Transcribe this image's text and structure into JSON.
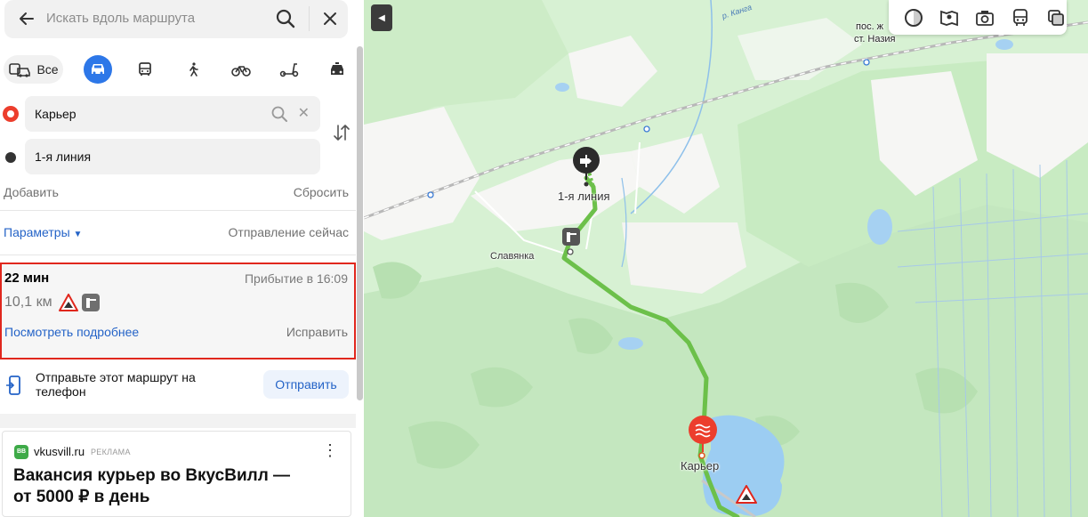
{
  "search": {
    "placeholder": "Искать вдоль маршрута"
  },
  "modes": {
    "all_label": "Все",
    "items": [
      "car",
      "bus",
      "walk",
      "bicycle",
      "scooter",
      "taxi"
    ],
    "active": "car",
    "accent": "#2d77e8"
  },
  "waypoints": {
    "from": "Карьер",
    "to": "1-я линия"
  },
  "actions": {
    "add": "Добавить",
    "reset": "Сбросить"
  },
  "params": {
    "label": "Параметры",
    "departure": "Отправление сейчас"
  },
  "route": {
    "duration": "22 мин",
    "arrival": "Прибытие в 16:09",
    "distance": "10,1 км",
    "details": "Посмотреть подробнее",
    "fix": "Исправить",
    "highlight_color": "#e0271d"
  },
  "send": {
    "text": "Отправьте этот маршрут на телефон",
    "button": "Отправить"
  },
  "ad": {
    "domain": "vkusvill.ru",
    "tag": "РЕКЛАМА",
    "title": "Вакансия курьер во ВкусВилл — от 5000 ₽ в день"
  },
  "map": {
    "labels": {
      "destination": "1-я линия",
      "village": "Славянка",
      "origin": "Карьер",
      "station_line1": "пос. ж",
      "station_line2": "ст. Назия",
      "river": "р. Канга"
    },
    "route_color": "#6cc04a",
    "toolbar": [
      "layers-icon",
      "panorama-icon",
      "photo-icon",
      "transit-icon",
      "copy-icon"
    ]
  }
}
